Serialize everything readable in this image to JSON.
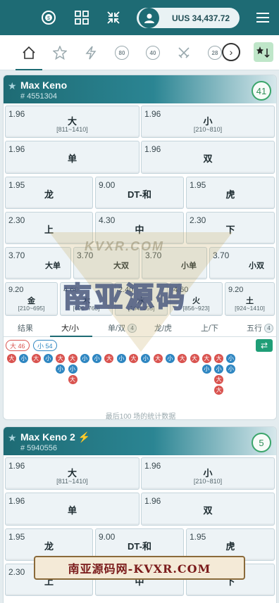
{
  "header": {
    "balance": "UUS 34,437.72",
    "icons": [
      "coin-icon",
      "grid-icon",
      "collapse-icon",
      "user-icon",
      "menu-icon"
    ]
  },
  "nav_tabs": [
    "home-icon",
    "star-icon",
    "bolt-icon",
    "80-ball-icon",
    "40-ball-icon",
    "swords-icon",
    "28-ball-icon"
  ],
  "nav_ball_labels": {
    "b80": "80",
    "b40": "40",
    "b28": "28"
  },
  "card1": {
    "title": "Max Keno",
    "id": "# 4551304",
    "count": "41"
  },
  "card2": {
    "title": "Max Keno 2",
    "id": "# 5940556",
    "count": "5"
  },
  "bets": {
    "r1": [
      {
        "odds": "1.96",
        "name": "大",
        "range": "[811~1410]"
      },
      {
        "odds": "1.96",
        "name": "小",
        "range": "[210~810]"
      }
    ],
    "r2": [
      {
        "odds": "1.96",
        "name": "单"
      },
      {
        "odds": "1.96",
        "name": "双"
      }
    ],
    "r3": [
      {
        "odds": "1.95",
        "name": "龙"
      },
      {
        "odds": "9.00",
        "name": "DT-和"
      },
      {
        "odds": "1.95",
        "name": "虎"
      }
    ],
    "r4": [
      {
        "odds": "2.30",
        "name": "上"
      },
      {
        "odds": "4.30",
        "name": "中"
      },
      {
        "odds": "2.30",
        "name": "下"
      }
    ],
    "r5": [
      {
        "odds": "3.70",
        "name": "大单"
      },
      {
        "odds": "3.70",
        "name": "大双"
      },
      {
        "odds": "3.70",
        "name": "小单"
      },
      {
        "odds": "3.70",
        "name": "小双"
      }
    ],
    "r6": [
      {
        "odds": "9.20",
        "name": "金",
        "range": "[210~695]"
      },
      {
        "odds": "4.60",
        "name": "木",
        "range": "[696~763]"
      },
      {
        "odds": "2.40",
        "name": "水",
        "range": "[764~855]"
      },
      {
        "odds": "4.60",
        "name": "火",
        "range": "[856~923]"
      },
      {
        "odds": "9.20",
        "name": "土",
        "range": "[924~1410]"
      }
    ]
  },
  "stats_tabs": [
    {
      "label": "结果"
    },
    {
      "label": "大/小"
    },
    {
      "label": "单/双",
      "badge": "4"
    },
    {
      "label": "龙/虎"
    },
    {
      "label": "上/下"
    },
    {
      "label": "五行",
      "badge": "4"
    }
  ],
  "counts": {
    "big": "大 46",
    "small": "小 54"
  },
  "dot_labels": {
    "big": "大",
    "small": "小"
  },
  "footer_note": "最后100 场的统计数据",
  "watermark": {
    "line1": "KVXR.COM",
    "line2": "南亚源码",
    "banner": "南亚源码网-KVXR.COM"
  }
}
